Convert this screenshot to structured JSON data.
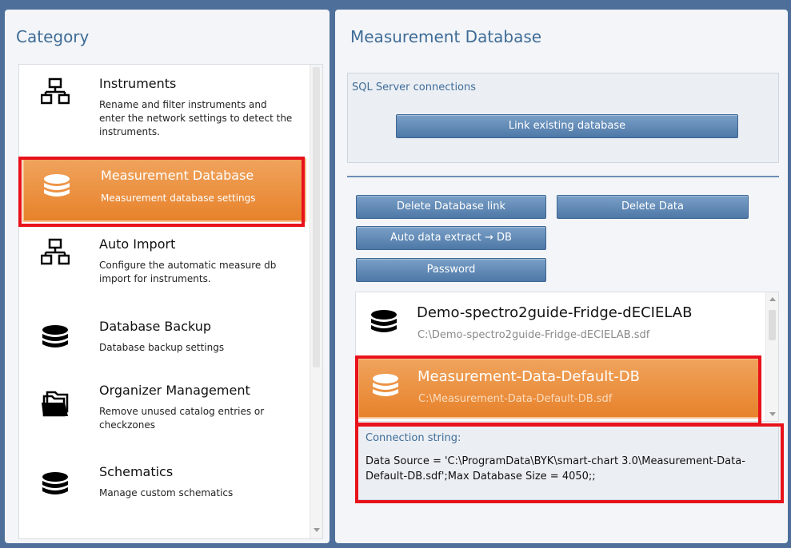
{
  "category_panel": {
    "title": "Category",
    "items": [
      {
        "icon": "network-icon",
        "title": "Instruments",
        "description": "Rename and filter instruments and enter the network settings to detect the instruments.",
        "selected": false
      },
      {
        "icon": "database-icon",
        "title": "Measurement Database",
        "description": "Measurement database settings",
        "selected": true
      },
      {
        "icon": "network-icon",
        "title": "Auto Import",
        "description": "Configure the automatic measure db import for instruments.",
        "selected": false
      },
      {
        "icon": "database-icon",
        "title": "Database Backup",
        "description": "Database backup settings",
        "selected": false
      },
      {
        "icon": "folder-icon",
        "title": "Organizer Management",
        "description": "Remove unused catalog entries or checkzones",
        "selected": false
      },
      {
        "icon": "database-icon",
        "title": "Schematics",
        "description": "Manage custom schematics",
        "selected": false
      }
    ]
  },
  "database_panel": {
    "title": "Measurement Database",
    "sql_section_label": "SQL Server connections",
    "link_button": "Link existing database",
    "buttons": {
      "delete_link": "Delete Database link",
      "delete_data": "Delete Data",
      "auto_extract": "Auto data extract → DB",
      "password": "Password"
    },
    "databases": [
      {
        "name": "Demo-spectro2guide-Fridge-dECIELAB",
        "path": "C:\\Demo-spectro2guide-Fridge-dECIELAB.sdf",
        "selected": false
      },
      {
        "name": "Measurement-Data-Default-DB",
        "path": "C:\\Measurement-Data-Default-DB.sdf",
        "selected": true
      }
    ],
    "connection_label": "Connection string:",
    "connection_value": "Data Source = 'C:\\ProgramData\\BYK\\smart-chart 3.0\\Measurement-Data-Default-DB.sdf';Max Database Size = 4050;;"
  },
  "colors": {
    "background": "#4d6f99",
    "accent_text": "#3f6c97",
    "selection_orange": "#e7822b",
    "highlight_red": "#e8121b",
    "button_blue": "#5a84b2"
  }
}
